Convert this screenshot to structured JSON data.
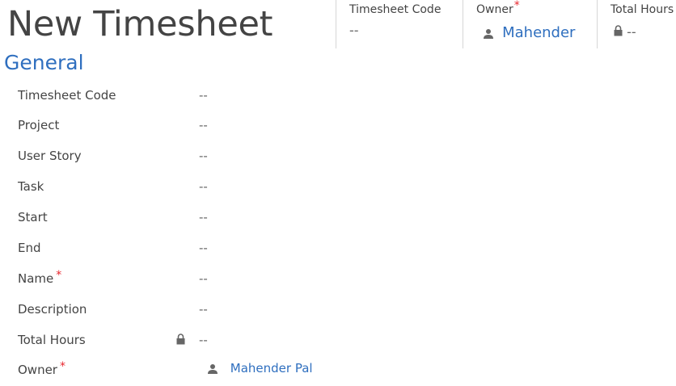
{
  "header": {
    "title": "New Timesheet",
    "fields": [
      {
        "label": "Timesheet Code",
        "value": "--"
      },
      {
        "label": "Owner",
        "required_mark": "*",
        "value": "Mahender",
        "icon": "user-icon"
      },
      {
        "label": "Total Hours",
        "value": "--",
        "icon": "lock-icon"
      }
    ]
  },
  "section": {
    "title": "General"
  },
  "form": {
    "rows": [
      {
        "label": "Timesheet Code",
        "value": "--"
      },
      {
        "label": "Project",
        "value": "--"
      },
      {
        "label": "User Story",
        "value": "--"
      },
      {
        "label": "Task",
        "value": "--"
      },
      {
        "label": "Start",
        "value": "--"
      },
      {
        "label": "End",
        "value": "--"
      },
      {
        "label": "Name",
        "required_mark": "*",
        "value": "--"
      },
      {
        "label": "Description",
        "value": "--"
      },
      {
        "label": "Total Hours",
        "value": "--",
        "icon": "lock-icon"
      },
      {
        "label": "Owner",
        "required_mark": "*",
        "value": "Mahender Pal",
        "icon": "user-icon"
      }
    ]
  },
  "colors": {
    "accent": "#2f6fbf",
    "required": "#e8272e",
    "text": "#444444"
  }
}
